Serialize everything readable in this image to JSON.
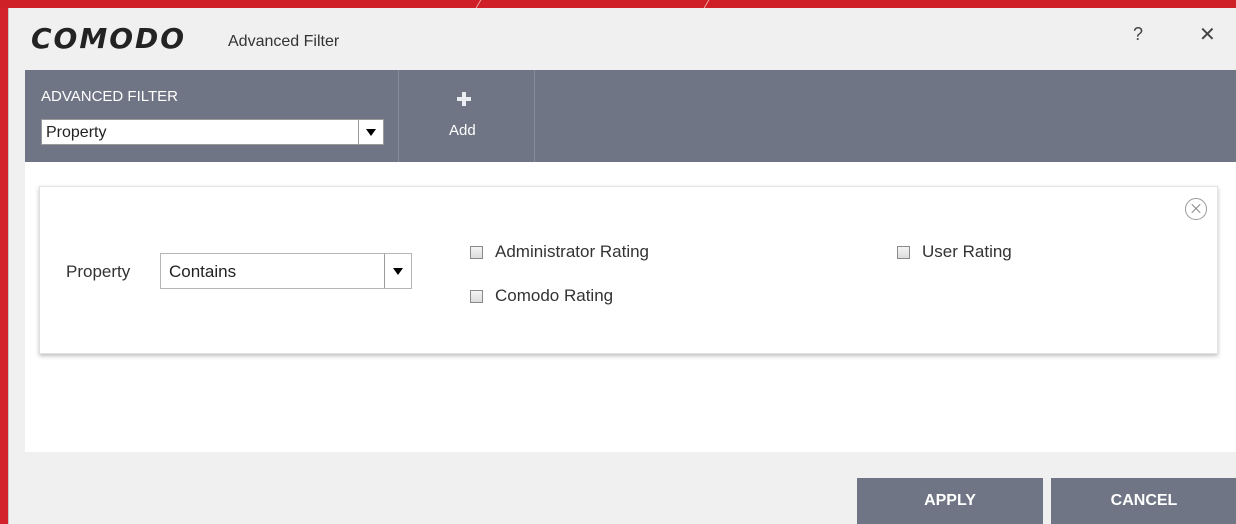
{
  "window": {
    "logo": "COMODO",
    "title": "Advanced Filter",
    "help": "?",
    "close": "✕"
  },
  "toolbar": {
    "section_label": "ADVANCED FILTER",
    "filter_select_value": "Property",
    "add_label": "Add"
  },
  "filter": {
    "property_label": "Property",
    "condition_value": "Contains",
    "checkboxes": [
      {
        "label": "Administrator Rating",
        "checked": false
      },
      {
        "label": "Comodo Rating",
        "checked": false
      },
      {
        "label": "User Rating",
        "checked": false
      }
    ]
  },
  "footer": {
    "apply_label": "APPLY",
    "cancel_label": "CANCEL"
  },
  "colors": {
    "accent_bar": "#6f7584",
    "outer_brand": "#d4222c"
  }
}
